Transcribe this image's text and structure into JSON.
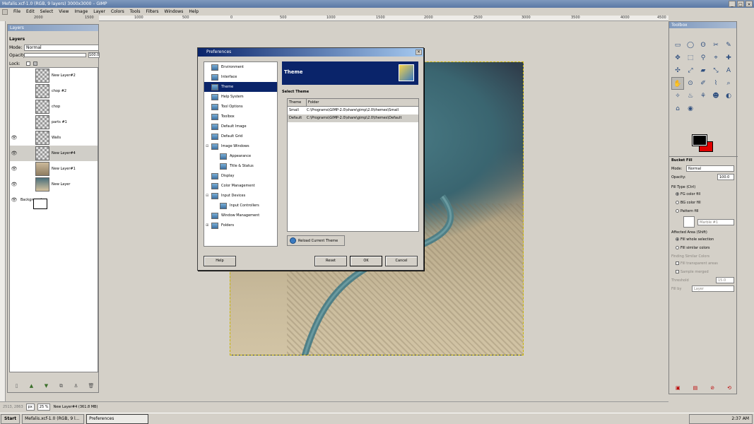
{
  "window": {
    "title": "Mefalis.xcf-1.0 (RGB, 9 layers) 3000x3000 – GIMP",
    "controls": [
      "_",
      "□",
      "×"
    ]
  },
  "menubar": [
    "File",
    "Edit",
    "Select",
    "View",
    "Image",
    "Layer",
    "Colors",
    "Tools",
    "Filters",
    "Windows",
    "Help"
  ],
  "ruler": [
    "2000",
    "1500",
    "1000",
    "500",
    "0",
    "500",
    "1000",
    "1500",
    "2000",
    "2500",
    "3000",
    "3500",
    "4000",
    "4500"
  ],
  "layers_panel": {
    "title": "Layers",
    "tab_label": "Layers",
    "mode_label": "Mode:",
    "mode_value": "Normal",
    "opacity_label": "Opacity:",
    "opacity_value": "100.0",
    "lock_label": "Lock:",
    "layers": [
      {
        "name": "New Layer#2",
        "visible": false,
        "thumb": "checker"
      },
      {
        "name": "chop #2",
        "visible": false,
        "thumb": "checker"
      },
      {
        "name": "chop",
        "visible": false,
        "thumb": "checker"
      },
      {
        "name": "parts #1",
        "visible": false,
        "thumb": "checker"
      },
      {
        "name": "Walls",
        "visible": true,
        "thumb": "checker"
      },
      {
        "name": "New Layer#4",
        "visible": true,
        "thumb": "checker",
        "selected": true
      },
      {
        "name": "New Layer#1",
        "visible": true,
        "thumb": "map"
      },
      {
        "name": "New Layer",
        "visible": true,
        "thumb": "map2"
      },
      {
        "name": "Background",
        "visible": true,
        "thumb": "bg"
      }
    ]
  },
  "toolbox": {
    "title": "Toolbox",
    "tools": [
      "▭",
      "◯",
      "ʘ",
      "✂",
      "✎",
      "✥",
      "⬚",
      "⚲",
      "⌖",
      "✚",
      "✣",
      "⤢",
      "▰",
      "⤡",
      "A",
      "✋",
      "⊙",
      "✐",
      "⌇",
      "⌕",
      "✧",
      "♨",
      "⚘",
      "☻",
      "◐",
      "⌂",
      "◉",
      "",
      "",
      ""
    ],
    "options_title": "Bucket Fill",
    "mode_label": "Mode:",
    "mode_value": "Normal",
    "opacity_label": "Opacity:",
    "opacity_value": "100.0",
    "fill_type_label": "Fill Type (Ctrl)",
    "fill_fg": "FG color fill",
    "fill_bg": "BG color fill",
    "fill_pattern": "Pattern fill",
    "pattern_name": "Marble #1",
    "affected_label": "Affected Area (Shift)",
    "affected_whole": "Fill whole selection",
    "affected_similar": "Fill similar colors",
    "finding_label": "Finding Similar Colors",
    "fill_transparent": "Fill transparent areas",
    "sample_merged": "Sample merged",
    "threshold_label": "Threshold",
    "threshold_value": "15.0",
    "fill_by_label": "Fill by",
    "fill_by_value": "Layer"
  },
  "statusbar": {
    "coords": "2513, 2863",
    "unit": "px",
    "zoom": "25 %",
    "message": "New Layer#4 (361.8 MB)"
  },
  "taskbar": {
    "start": "Start",
    "tasks": [
      "Mefalis.xcf-1.0 (RGB, 9 l...",
      "Preferences"
    ],
    "clock": "2:37 AM"
  },
  "preferences": {
    "title": "Preferences",
    "nav": [
      {
        "label": "Environment",
        "level": 0
      },
      {
        "label": "Interface",
        "level": 0
      },
      {
        "label": "Theme",
        "level": 0,
        "selected": true
      },
      {
        "label": "Help System",
        "level": 0
      },
      {
        "label": "Tool Options",
        "level": 0
      },
      {
        "label": "Toolbox",
        "level": 0
      },
      {
        "label": "Default Image",
        "level": 0
      },
      {
        "label": "Default Grid",
        "level": 0
      },
      {
        "label": "Image Windows",
        "level": 0,
        "expander": "⊟"
      },
      {
        "label": "Appearance",
        "level": 1
      },
      {
        "label": "Title & Status",
        "level": 1
      },
      {
        "label": "Display",
        "level": 0
      },
      {
        "label": "Color Management",
        "level": 0
      },
      {
        "label": "Input Devices",
        "level": 0,
        "expander": "⊟"
      },
      {
        "label": "Input Controllers",
        "level": 1
      },
      {
        "label": "Window Management",
        "level": 0
      },
      {
        "label": "Folders",
        "level": 0,
        "expander": "⊞"
      }
    ],
    "banner": "Theme",
    "section": "Select Theme",
    "columns": [
      "Theme",
      "Folder"
    ],
    "themes": [
      {
        "theme": "Small",
        "folder": "C:\\Programs\\GIMP-2.0\\share\\gimp\\2.0\\themes\\Small"
      },
      {
        "theme": "Default",
        "folder": "C:\\Programs\\GIMP-2.0\\share\\gimp\\2.0\\themes\\Default",
        "selected": true
      }
    ],
    "reload_label": "Reload Current Theme",
    "help_label": "Help",
    "reset_label": "Reset",
    "ok_label": "OK",
    "cancel_label": "Cancel"
  }
}
